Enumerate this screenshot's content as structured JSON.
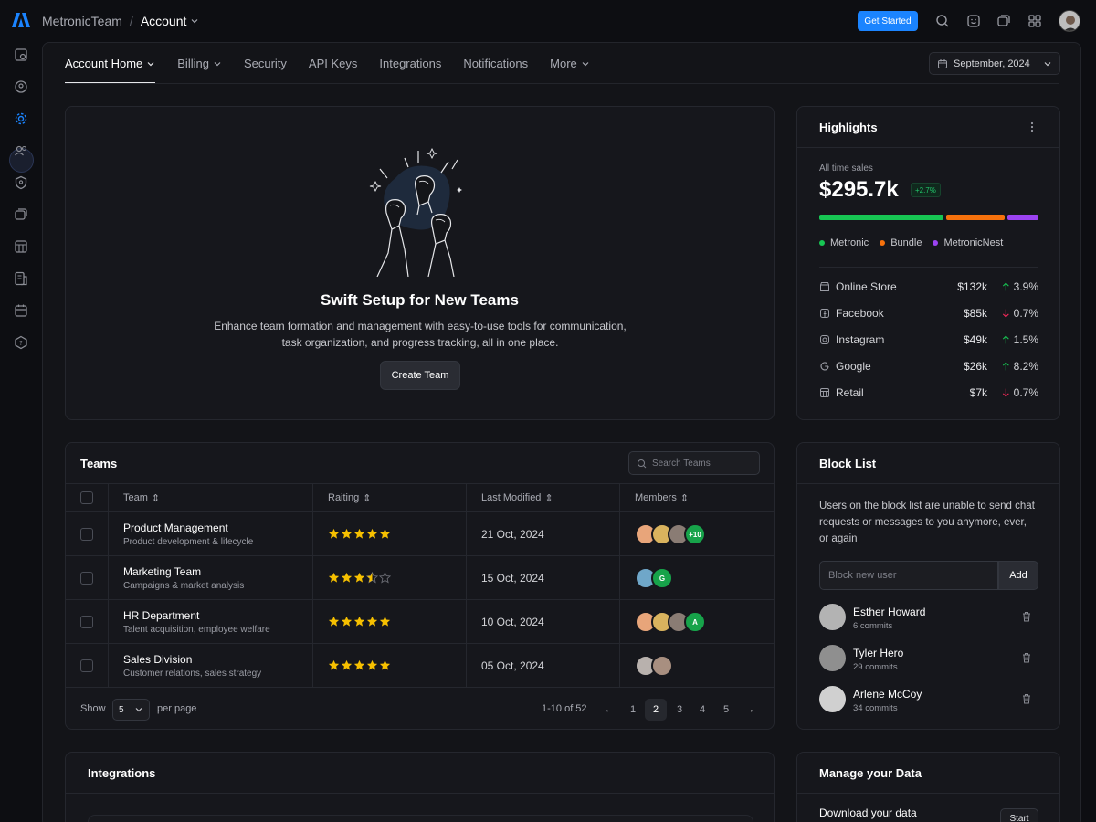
{
  "topbar": {
    "team": "MetronicTeam",
    "separator": "/",
    "page": "Account",
    "cta_label": "Get Started"
  },
  "tabs": [
    {
      "label": "Account Home",
      "dropdown": true
    },
    {
      "label": "Billing",
      "dropdown": true
    },
    {
      "label": "Security",
      "dropdown": false
    },
    {
      "label": "API Keys",
      "dropdown": false
    },
    {
      "label": "Integrations",
      "dropdown": false
    },
    {
      "label": "Notifications",
      "dropdown": false
    },
    {
      "label": "More",
      "dropdown": true
    }
  ],
  "date_picker": {
    "label": "September, 2024"
  },
  "hero": {
    "title": "Swift Setup for New Teams",
    "description": "Enhance team formation and management with easy-to-use tools for communication, task organization, and progress tracking, all in one place.",
    "button_label": "Create Team"
  },
  "highlights": {
    "title": "Highlights",
    "label": "All time sales",
    "value": "$295.7k",
    "badge": "+2.7%",
    "legend": [
      {
        "name": "Metronic",
        "color": "#17c653"
      },
      {
        "name": "Bundle",
        "color": "#f6710c"
      },
      {
        "name": "MetronicNest",
        "color": "#9b43f1"
      }
    ],
    "rows": [
      {
        "name": "Online Store",
        "value": "$132k",
        "change": "3.9%",
        "direction": "up"
      },
      {
        "name": "Facebook",
        "value": "$85k",
        "change": "0.7%",
        "direction": "down"
      },
      {
        "name": "Instagram",
        "value": "$49k",
        "change": "1.5%",
        "direction": "up"
      },
      {
        "name": "Google",
        "value": "$26k",
        "change": "8.2%",
        "direction": "up"
      },
      {
        "name": "Retail",
        "value": "$7k",
        "change": "0.7%",
        "direction": "down"
      }
    ]
  },
  "teams": {
    "title": "Teams",
    "search_placeholder": "Search Teams",
    "columns": [
      "Team",
      "Raiting",
      "Last Modified",
      "Members"
    ],
    "rows": [
      {
        "name": "Product Management",
        "desc": "Product development & lifecycle",
        "rating": 5,
        "date": "21 Oct, 2024",
        "extra": "+10"
      },
      {
        "name": "Marketing Team",
        "desc": "Campaigns & market analysis",
        "rating": 3.5,
        "date": "15 Oct, 2024",
        "extra": "G"
      },
      {
        "name": "HR Department",
        "desc": "Talent acquisition, employee welfare",
        "rating": 5,
        "date": "10 Oct, 2024",
        "extra": "A"
      },
      {
        "name": "Sales Division",
        "desc": "Customer relations, sales strategy",
        "rating": 5,
        "date": "05 Oct, 2024",
        "extra": ""
      }
    ],
    "footer": {
      "show": "Show",
      "per_page_value": "5",
      "per_page": "per page",
      "range": "1-10 of 52",
      "pages": [
        "1",
        "2",
        "3",
        "4",
        "5"
      ],
      "current_page": "2"
    }
  },
  "block_list": {
    "title": "Block List",
    "description": "Users on the block list are unable to send chat requests or messages to you anymore, ever, or again",
    "input_placeholder": "Block new user",
    "add_label": "Add",
    "users": [
      {
        "name": "Esther Howard",
        "commits": "6 commits"
      },
      {
        "name": "Tyler Hero",
        "commits": "29 commits"
      },
      {
        "name": "Arlene McCoy",
        "commits": "34 commits"
      }
    ]
  },
  "integrations": {
    "title": "Integrations"
  },
  "manage_data": {
    "title": "Manage your Data",
    "download_label": "Download your data",
    "start_label": "Start"
  }
}
